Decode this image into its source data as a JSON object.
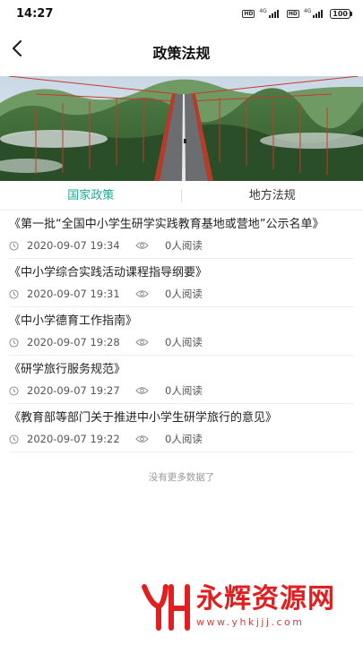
{
  "status_bar": {
    "time": "14:27",
    "sim1_label": "HD",
    "sim1_net": "4G",
    "sim2_label": "HD",
    "sim2_net": "4G",
    "battery": "100"
  },
  "header": {
    "title": "政策法规"
  },
  "tabs": [
    {
      "label": "国家政策",
      "active": true
    },
    {
      "label": "地方法规",
      "active": false
    }
  ],
  "articles": [
    {
      "title": "《第一批“全国中小学生研学实践教育基地或营地”公示名单》",
      "time": "2020-09-07 19:34",
      "views": "0人阅读"
    },
    {
      "title": "《中小学综合实践活动课程指导纲要》",
      "time": "2020-09-07 19:31",
      "views": "0人阅读"
    },
    {
      "title": "《中小学德育工作指南》",
      "time": "2020-09-07 19:28",
      "views": "0人阅读"
    },
    {
      "title": "《研学旅行服务规范》",
      "time": "2020-09-07 19:27",
      "views": "0人阅读"
    },
    {
      "title": "《教育部等部门关于推进中小学生研学旅行的意见》",
      "time": "2020-09-07 19:22",
      "views": "0人阅读"
    }
  ],
  "footer": {
    "no_more": "没有更多数据了"
  },
  "watermark": {
    "name": "永辉资源网",
    "url": "www.yhkjjj.com"
  },
  "colors": {
    "accent": "#1aa996",
    "watermark": "#e02020"
  },
  "icons": {
    "back": "chevron-left-icon",
    "time": "clock-icon",
    "views": "eye-icon"
  }
}
